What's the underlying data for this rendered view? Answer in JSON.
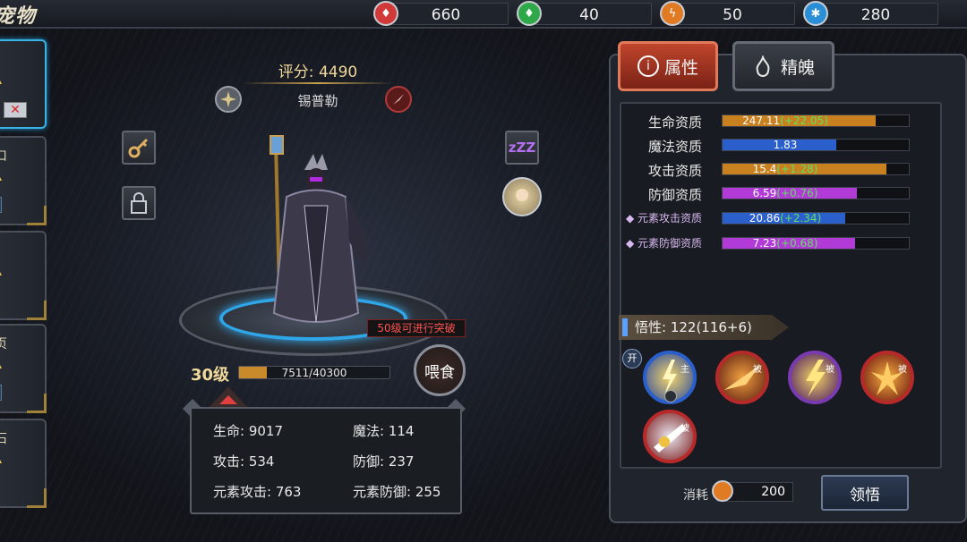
{
  "header": {
    "title": "宠物"
  },
  "resources": [
    {
      "name": "red-gem",
      "value": "660",
      "color": "#d23a3a"
    },
    {
      "name": "green-gem",
      "value": "40",
      "color": "#2fa84a"
    },
    {
      "name": "orange-gem",
      "value": "50",
      "color": "#e07a23"
    },
    {
      "name": "blue-gem",
      "value": "280",
      "color": "#2a8fd6"
    }
  ],
  "pet": {
    "score_label": "评分:",
    "score": "4490",
    "name": "锡普勒",
    "level": "30级",
    "exp_text": "7511/40300",
    "exp_fraction": 0.186,
    "break_hint": "50级可进行突破",
    "feed_label": "喂食"
  },
  "stats": {
    "hp": "生命: 9017",
    "mp": "魔法: 114",
    "atk": "攻击: 534",
    "def": "防御: 237",
    "elem_atk": "元素攻击: 763",
    "elem_def": "元素防御: 255"
  },
  "tabs": {
    "attr": "属性",
    "soul": "精魄"
  },
  "aptitudes": [
    {
      "label": "生命资质",
      "base": "247.11",
      "bonus": "(+22.05)",
      "fill": 0.82,
      "color": "#c9811f",
      "small": false
    },
    {
      "label": "魔法资质",
      "base": "1.83",
      "bonus": "",
      "fill": 0.61,
      "color": "#2a5fcc",
      "small": false
    },
    {
      "label": "攻击资质",
      "base": "15.4",
      "bonus": "(+1.28)",
      "fill": 0.88,
      "color": "#c9811f",
      "small": false
    },
    {
      "label": "防御资质",
      "base": "6.59",
      "bonus": "(+0.76)",
      "fill": 0.72,
      "color": "#b23ad6",
      "small": false
    },
    {
      "label": "◆ 元素攻击资质",
      "base": "20.86",
      "bonus": "(+2.34)",
      "fill": 0.66,
      "color": "#2a5fcc",
      "small": true
    },
    {
      "label": "◆ 元素防御资质",
      "base": "7.23",
      "bonus": "(+0.68)",
      "fill": 0.71,
      "color": "#b23ad6",
      "small": true
    }
  ],
  "wuxing": {
    "label": "悟性: 122(116+6)",
    "open": "开"
  },
  "skills": [
    {
      "tag": "主",
      "icon": "lightning-strike-skill-icon"
    },
    {
      "tag": "被",
      "icon": "flame-slash-skill-icon"
    },
    {
      "tag": "被",
      "icon": "thunder-claw-skill-icon"
    },
    {
      "tag": "被",
      "icon": "fire-burst-skill-icon"
    },
    {
      "tag": "被",
      "icon": "shield-break-skill-icon"
    }
  ],
  "consume": {
    "label": "消耗",
    "value": "200"
  },
  "comprehend_label": "领悟"
}
